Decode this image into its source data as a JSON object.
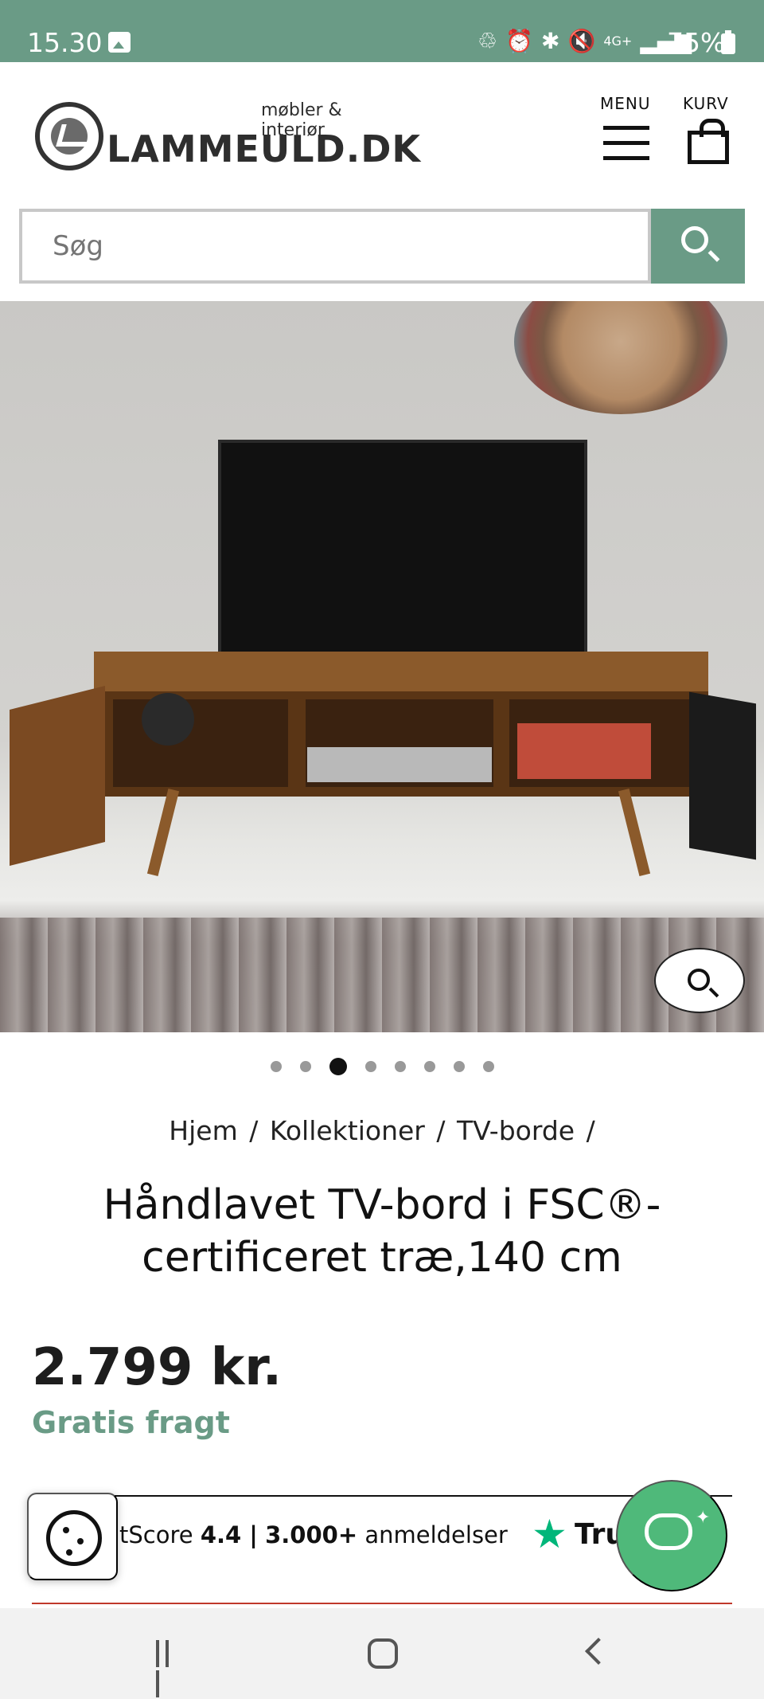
{
  "status_bar": {
    "time": "15.30",
    "icons": [
      "gallery-icon",
      "recycle-icon",
      "alarm-icon",
      "bluetooth-icon",
      "mute-icon",
      "4g-icon",
      "signal-icon"
    ],
    "network": "4G+",
    "battery": "75%"
  },
  "header": {
    "logo_name": "LAMMEULD.DK",
    "logo_tagline": "møbler & interiør",
    "menu_label": "MENU",
    "cart_label": "KURV"
  },
  "search": {
    "placeholder": "Søg"
  },
  "gallery": {
    "image_count": 8,
    "active_index": 2,
    "zoom_icon": "search-icon"
  },
  "breadcrumb": [
    {
      "label": "Hjem"
    },
    {
      "label": "Kollektioner"
    },
    {
      "label": "TV-borde"
    }
  ],
  "breadcrumb_separator": "/",
  "product": {
    "title": "Håndlavet TV-bord i FSC®-certificeret træ,140 cm",
    "price": "2.799 kr.",
    "shipping": "Gratis fragt"
  },
  "trustpilot": {
    "score_prefix": "tScore",
    "score": "4.4 |",
    "count": "3.000+",
    "reviews_label": "anmeldelser",
    "brand": "Tru"
  },
  "colors": {
    "accent": "#6a9b86",
    "chat": "#4fb97a",
    "trust_star": "#00b67a"
  }
}
